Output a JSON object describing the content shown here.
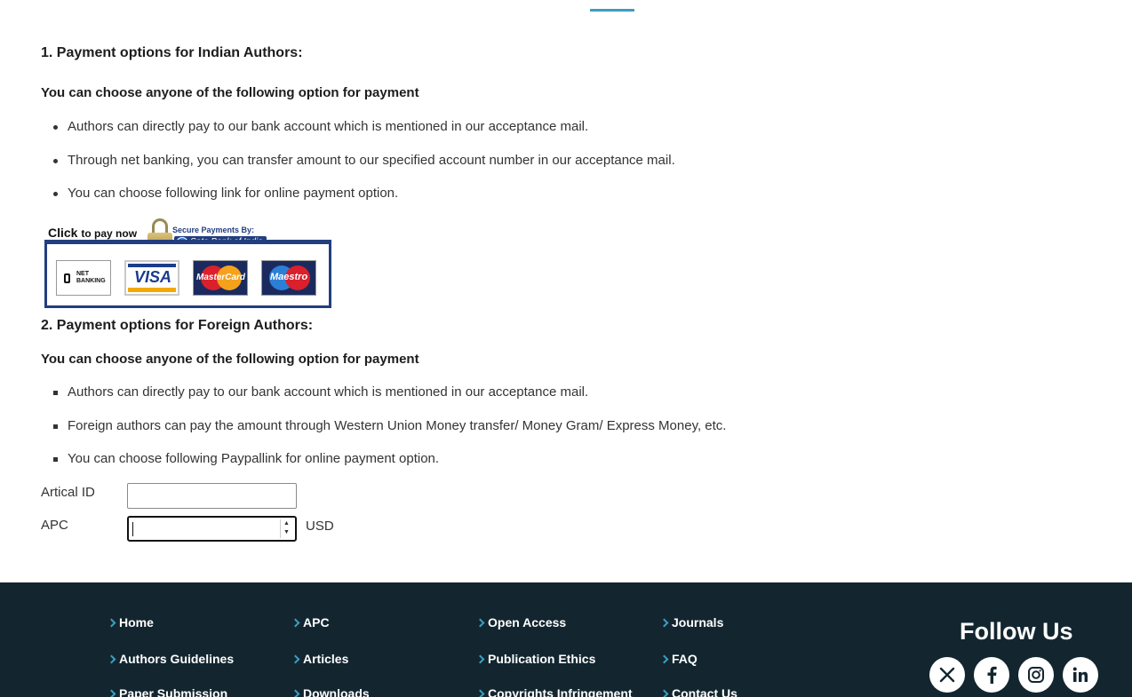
{
  "indian": {
    "heading": "1. Payment options for Indian Authors:",
    "subheading": "You can choose anyone of the following option for payment",
    "items": [
      "Authors can directly pay to our bank account which is mentioned in our acceptance mail.",
      "Through net banking, you can transfer amount to our specified account number in our acceptance mail.",
      "You can choose following link for online payment option."
    ]
  },
  "banner": {
    "click_text": "Click",
    "to_pay_text": "to pay now",
    "secure_text": "Secure Payments By:",
    "bank_text": "Sate Bank of India",
    "net_banking": "NET BANKING",
    "visa": "VISA",
    "mastercard": "MasterCard",
    "maestro": "Maestro"
  },
  "foreign": {
    "heading": "2. Payment options for Foreign Authors:",
    "subheading": "You can choose anyone of the following option for payment",
    "items": [
      "Authors can directly pay to our bank account which is mentioned in our acceptance mail.",
      "Foreign authors can pay the amount through Western Union Money transfer/ Money Gram/ Express Money, etc.",
      "You can choose following Paypallink for online payment option."
    ]
  },
  "form": {
    "article_label": "Artical ID",
    "article_value": "",
    "apc_label": "APC",
    "apc_value": "",
    "currency": "USD"
  },
  "footer": {
    "links": [
      "Home",
      "APC",
      "Open Access",
      "Journals",
      "Authors Guidelines",
      "Articles",
      "Publication Ethics",
      "FAQ",
      "Paper Submission",
      "Downloads",
      "Copyrights Infringement",
      "Contact Us"
    ],
    "follow_title": "Follow Us",
    "social_icons": [
      "x-icon",
      "facebook-icon",
      "instagram-icon",
      "linkedin-icon"
    ]
  },
  "colors": {
    "accent": "#3b9ec2",
    "footer_bg": "#13262f",
    "banner_blue": "#233e7e"
  }
}
